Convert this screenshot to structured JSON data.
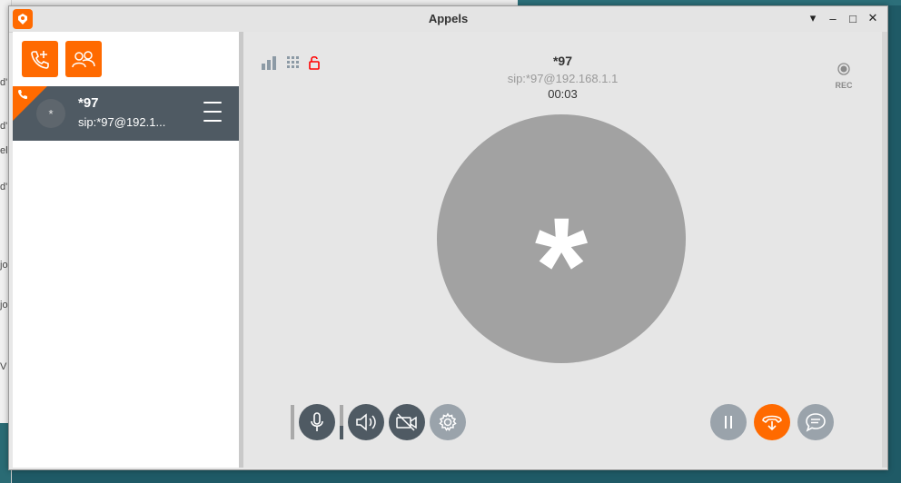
{
  "window": {
    "title": "Appels"
  },
  "title_controls": {
    "pin": "▾",
    "minimize": "–",
    "maximize": "□",
    "close": "✕"
  },
  "background_window_chars": [
    "d'",
    "d'",
    "el",
    "d'",
    "jo",
    "jo",
    "V"
  ],
  "call_list": [
    {
      "name": "*97",
      "uri": "sip:*97@192.1...",
      "avatar": "*"
    }
  ],
  "active_call": {
    "name": "*97",
    "uri": "sip:*97@192.168.1.1",
    "duration": "00:03",
    "avatar": "*",
    "rec_label": "REC"
  },
  "icons": {
    "app": "linphone-logo-icon",
    "new_call": "phone-plus-icon",
    "conference": "group-icon",
    "signal": "signal-bars-icon",
    "dialpad": "dialpad-icon",
    "security": "unlocked-padlock-icon",
    "record": "record-icon",
    "microphone": "microphone-icon",
    "speaker": "speaker-icon",
    "camera": "camera-off-icon",
    "settings": "gear-icon",
    "pause": "pause-icon",
    "hangup": "hangup-icon",
    "chat": "chat-bubble-icon"
  },
  "colors": {
    "accent": "#ff6a00",
    "call_item_bg": "#4f5a63",
    "avatar_bg": "#a2a2a2",
    "lock_red": "#ff0000"
  }
}
